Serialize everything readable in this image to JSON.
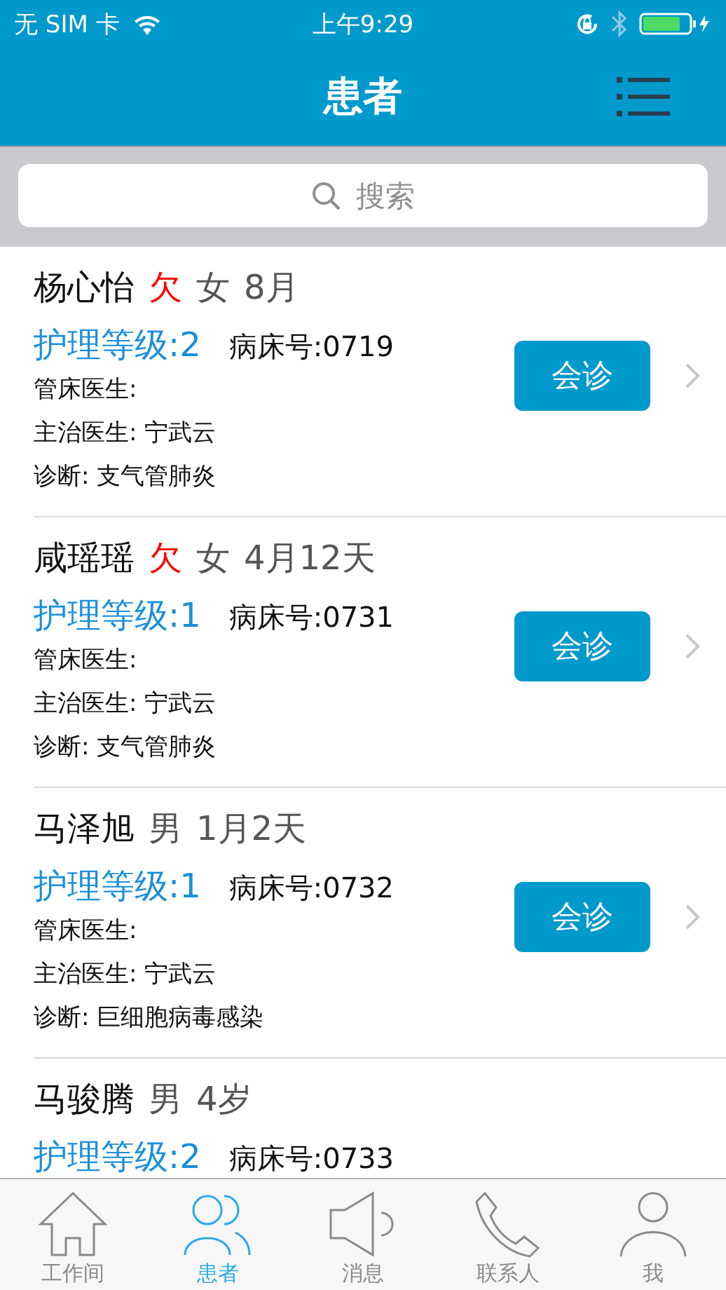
{
  "status_bar": {
    "carrier": "无 SIM 卡",
    "time": "上午9:29"
  },
  "header": {
    "title": "患者"
  },
  "search": {
    "placeholder": "搜索"
  },
  "patients": [
    {
      "name": "杨心怡",
      "arrears": "欠",
      "sex": "女",
      "age": "8月",
      "care_level": "护理等级:2",
      "bed": "病床号:0719",
      "bed_doctor": "管床医生:",
      "attending": "主治医生: 宁武云",
      "diagnosis": "诊断: 支气管肺炎",
      "consult": "会诊"
    },
    {
      "name": "咸瑶瑶",
      "arrears": "欠",
      "sex": "女",
      "age": "4月12天",
      "care_level": "护理等级:1",
      "bed": "病床号:0731",
      "bed_doctor": "管床医生:",
      "attending": "主治医生: 宁武云",
      "diagnosis": "诊断: 支气管肺炎",
      "consult": "会诊"
    },
    {
      "name": "马泽旭",
      "sex": "男",
      "age": "1月2天",
      "care_level": "护理等级:1",
      "bed": "病床号:0732",
      "bed_doctor": "管床医生:",
      "attending": "主治医生: 宁武云",
      "diagnosis": "诊断: 巨细胞病毒感染",
      "consult": "会诊"
    },
    {
      "name": "马骏腾",
      "sex": "男",
      "age": "4岁",
      "care_level": "护理等级:2",
      "bed": "病床号:0733"
    }
  ],
  "tab_bar": [
    {
      "label": "工作间",
      "selected": false
    },
    {
      "label": "患者",
      "selected": true
    },
    {
      "label": "消息",
      "selected": false
    },
    {
      "label": "联系人",
      "selected": false
    },
    {
      "label": "我",
      "selected": false
    }
  ]
}
